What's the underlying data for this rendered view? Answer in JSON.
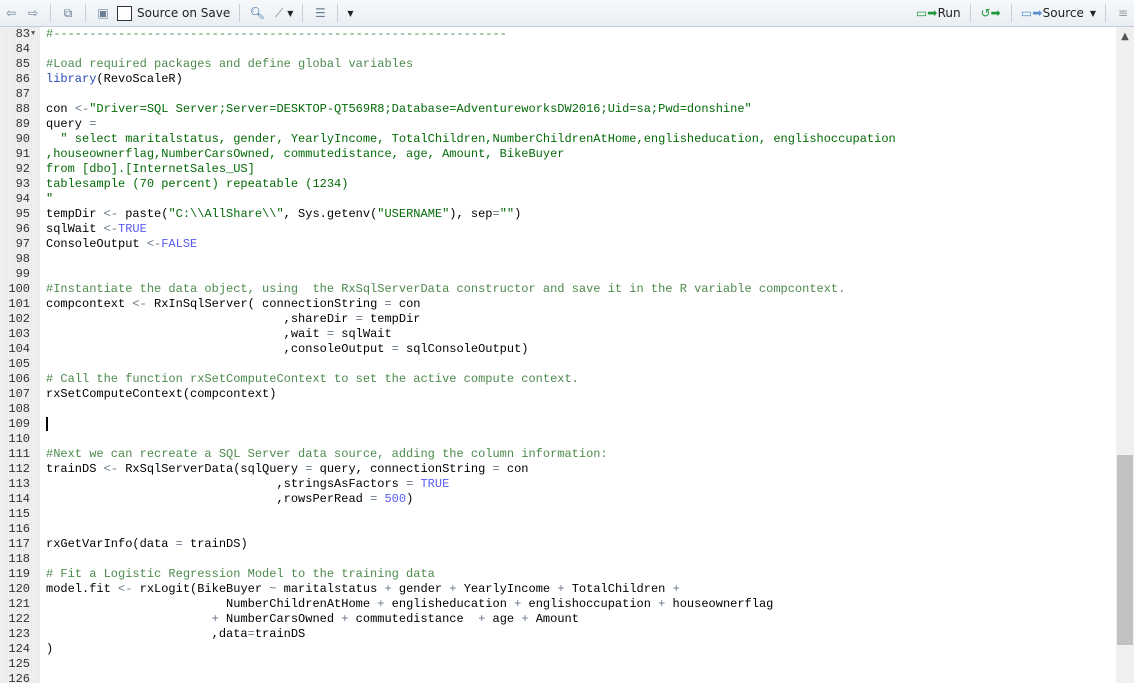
{
  "toolbar": {
    "source_on_save": "Source on Save",
    "run": "Run",
    "source": "Source"
  },
  "editor": {
    "lines": [
      {
        "n": "83",
        "fold": true,
        "t": [
          [
            "c",
            "#---------------------------------------------------------------"
          ]
        ]
      },
      {
        "n": "84",
        "t": []
      },
      {
        "n": "85",
        "t": [
          [
            "c",
            "#Load required packages and define global variables"
          ]
        ]
      },
      {
        "n": "86",
        "t": [
          [
            "f",
            "library"
          ],
          [
            "t",
            "(RevoScaleR)"
          ]
        ]
      },
      {
        "n": "87",
        "t": []
      },
      {
        "n": "88",
        "t": [
          [
            "t",
            "con "
          ],
          [
            "o",
            "<-"
          ],
          [
            "s",
            "\"Driver=SQL Server;Server=DESKTOP-QT569R8;Database=AdventureworksDW2016;Uid=sa;Pwd=donshine\""
          ]
        ]
      },
      {
        "n": "89",
        "t": [
          [
            "t",
            "query "
          ],
          [
            "o",
            "="
          ]
        ]
      },
      {
        "n": "90",
        "t": [
          [
            "s",
            "  \" select maritalstatus, gender, YearlyIncome, TotalChildren,NumberChildrenAtHome,englisheducation, englishoccupation"
          ]
        ]
      },
      {
        "n": "91",
        "t": [
          [
            "s",
            ",houseownerflag,NumberCarsOwned, commutedistance, age, Amount, BikeBuyer"
          ]
        ]
      },
      {
        "n": "92",
        "t": [
          [
            "s",
            "from [dbo].[InternetSales_US]"
          ]
        ]
      },
      {
        "n": "93",
        "t": [
          [
            "s",
            "tablesample (70 percent) repeatable (1234)"
          ]
        ]
      },
      {
        "n": "94",
        "t": [
          [
            "s",
            "\""
          ]
        ]
      },
      {
        "n": "95",
        "t": [
          [
            "t",
            "tempDir "
          ],
          [
            "o",
            "<-"
          ],
          [
            "t",
            " paste("
          ],
          [
            "s",
            "\"C:\\\\AllShare\\\\\""
          ],
          [
            "t",
            ", Sys.getenv("
          ],
          [
            "s",
            "\"USERNAME\""
          ],
          [
            "t",
            "), sep"
          ],
          [
            "o",
            "="
          ],
          [
            "s",
            "\"\""
          ],
          [
            "t",
            ")"
          ]
        ]
      },
      {
        "n": "96",
        "t": [
          [
            "t",
            "sqlWait "
          ],
          [
            "o",
            "<-"
          ],
          [
            "k",
            "TRUE"
          ]
        ]
      },
      {
        "n": "97",
        "t": [
          [
            "t",
            "ConsoleOutput "
          ],
          [
            "o",
            "<-"
          ],
          [
            "k",
            "FALSE"
          ]
        ]
      },
      {
        "n": "98",
        "t": []
      },
      {
        "n": "99",
        "t": []
      },
      {
        "n": "100",
        "t": [
          [
            "c",
            "#Instantiate the data object, using  the RxSqlServerData constructor and save it in the R variable compcontext."
          ]
        ]
      },
      {
        "n": "101",
        "t": [
          [
            "t",
            "compcontext "
          ],
          [
            "o",
            "<-"
          ],
          [
            "t",
            " RxInSqlServer( connectionString "
          ],
          [
            "o",
            "="
          ],
          [
            "t",
            " con"
          ]
        ]
      },
      {
        "n": "102",
        "t": [
          [
            "t",
            "                                 ,shareDir "
          ],
          [
            "o",
            "="
          ],
          [
            "t",
            " tempDir"
          ]
        ]
      },
      {
        "n": "103",
        "t": [
          [
            "t",
            "                                 ,wait "
          ],
          [
            "o",
            "="
          ],
          [
            "t",
            " sqlWait"
          ]
        ]
      },
      {
        "n": "104",
        "t": [
          [
            "t",
            "                                 ,consoleOutput "
          ],
          [
            "o",
            "="
          ],
          [
            "t",
            " sqlConsoleOutput)"
          ]
        ]
      },
      {
        "n": "105",
        "t": []
      },
      {
        "n": "106",
        "t": [
          [
            "c",
            "# Call the function rxSetComputeContext to set the active compute context."
          ]
        ]
      },
      {
        "n": "107",
        "t": [
          [
            "t",
            "rxSetComputeContext(compcontext)"
          ]
        ]
      },
      {
        "n": "108",
        "t": []
      },
      {
        "n": "109",
        "cursor": true,
        "t": []
      },
      {
        "n": "110",
        "t": []
      },
      {
        "n": "111",
        "t": [
          [
            "c",
            "#Next we can recreate a SQL Server data source, adding the column information:"
          ]
        ]
      },
      {
        "n": "112",
        "t": [
          [
            "t",
            "trainDS "
          ],
          [
            "o",
            "<-"
          ],
          [
            "t",
            " RxSqlServerData(sqlQuery "
          ],
          [
            "o",
            "="
          ],
          [
            "t",
            " query, connectionString "
          ],
          [
            "o",
            "="
          ],
          [
            "t",
            " con"
          ]
        ]
      },
      {
        "n": "113",
        "t": [
          [
            "t",
            "                                ,stringsAsFactors "
          ],
          [
            "o",
            "="
          ],
          [
            "t",
            " "
          ],
          [
            "k",
            "TRUE"
          ]
        ]
      },
      {
        "n": "114",
        "t": [
          [
            "t",
            "                                ,rowsPerRead "
          ],
          [
            "o",
            "="
          ],
          [
            "t",
            " "
          ],
          [
            "k",
            "500"
          ],
          [
            "t",
            ")"
          ]
        ]
      },
      {
        "n": "115",
        "t": []
      },
      {
        "n": "116",
        "t": []
      },
      {
        "n": "117",
        "t": [
          [
            "t",
            "rxGetVarInfo(data "
          ],
          [
            "o",
            "="
          ],
          [
            "t",
            " trainDS)"
          ]
        ]
      },
      {
        "n": "118",
        "t": []
      },
      {
        "n": "119",
        "t": [
          [
            "c",
            "# Fit a Logistic Regression Model to the training data"
          ]
        ]
      },
      {
        "n": "120",
        "t": [
          [
            "t",
            "model.fit "
          ],
          [
            "o",
            "<-"
          ],
          [
            "t",
            " rxLogit(BikeBuyer "
          ],
          [
            "o",
            "~"
          ],
          [
            "t",
            " maritalstatus "
          ],
          [
            "o",
            "+"
          ],
          [
            "t",
            " gender "
          ],
          [
            "o",
            "+"
          ],
          [
            "t",
            " YearlyIncome "
          ],
          [
            "o",
            "+"
          ],
          [
            "t",
            " TotalChildren "
          ],
          [
            "o",
            "+"
          ]
        ]
      },
      {
        "n": "121",
        "t": [
          [
            "t",
            "                         NumberChildrenAtHome "
          ],
          [
            "o",
            "+"
          ],
          [
            "t",
            " englisheducation "
          ],
          [
            "o",
            "+"
          ],
          [
            "t",
            " englishoccupation "
          ],
          [
            "o",
            "+"
          ],
          [
            "t",
            " houseownerflag"
          ]
        ]
      },
      {
        "n": "122",
        "t": [
          [
            "t",
            "                       "
          ],
          [
            "o",
            "+"
          ],
          [
            "t",
            " NumberCarsOwned "
          ],
          [
            "o",
            "+"
          ],
          [
            "t",
            " commutedistance  "
          ],
          [
            "o",
            "+"
          ],
          [
            "t",
            " age "
          ],
          [
            "o",
            "+"
          ],
          [
            "t",
            " Amount"
          ]
        ]
      },
      {
        "n": "123",
        "t": [
          [
            "t",
            "                       ,data"
          ],
          [
            "o",
            "="
          ],
          [
            "t",
            "trainDS"
          ]
        ]
      },
      {
        "n": "124",
        "t": [
          [
            "t",
            ")"
          ]
        ]
      },
      {
        "n": "125",
        "t": []
      },
      {
        "n": "126",
        "t": []
      }
    ]
  }
}
